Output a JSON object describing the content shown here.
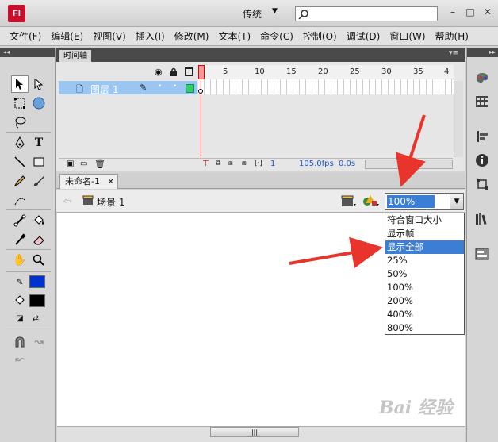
{
  "app": {
    "logo": "Fl",
    "workspace": "传统",
    "workspace_arrow": "▼",
    "search_value": ""
  },
  "window_buttons": {
    "minimize": "–",
    "restore": "□",
    "close": "✕"
  },
  "menu": [
    "文件(F)",
    "编辑(E)",
    "视图(V)",
    "插入(I)",
    "修改(M)",
    "文本(T)",
    "命令(C)",
    "控制(O)",
    "调试(D)",
    "窗口(W)",
    "帮助(H)"
  ],
  "timeline": {
    "tab": "时间轴",
    "layer_name": "图层 1",
    "frame_numbers": [
      "1",
      "5",
      "10",
      "15",
      "20",
      "25",
      "30",
      "35",
      "4"
    ],
    "current_frame": "1",
    "fps": "105.0fps",
    "time": "0.0s"
  },
  "document": {
    "tab": "未命名-1",
    "tab_close": "✕",
    "scene": "场景 1"
  },
  "zoom": {
    "value": "100%",
    "options": [
      "符合窗口大小",
      "显示帧",
      "显示全部",
      "25%",
      "50%",
      "100%",
      "200%",
      "400%",
      "800%"
    ],
    "highlighted": "显示全部"
  },
  "colors": {
    "stroke": "#0033cc",
    "fill": "#000000",
    "accent": "#3a7fd5",
    "arrow": "#e8342a"
  },
  "watermark": "Bai 经验",
  "icons": [
    "arrow-icon",
    "subselect-icon",
    "free-transform-icon",
    "3d-rotation-icon",
    "lasso-icon",
    "pen-icon",
    "text-icon",
    "line-icon",
    "rectangle-icon",
    "pencil-icon",
    "brush-icon",
    "deco-icon",
    "bone-icon",
    "paint-bucket-icon",
    "eyedropper-icon",
    "eraser-icon",
    "hand-icon",
    "zoom-icon"
  ]
}
